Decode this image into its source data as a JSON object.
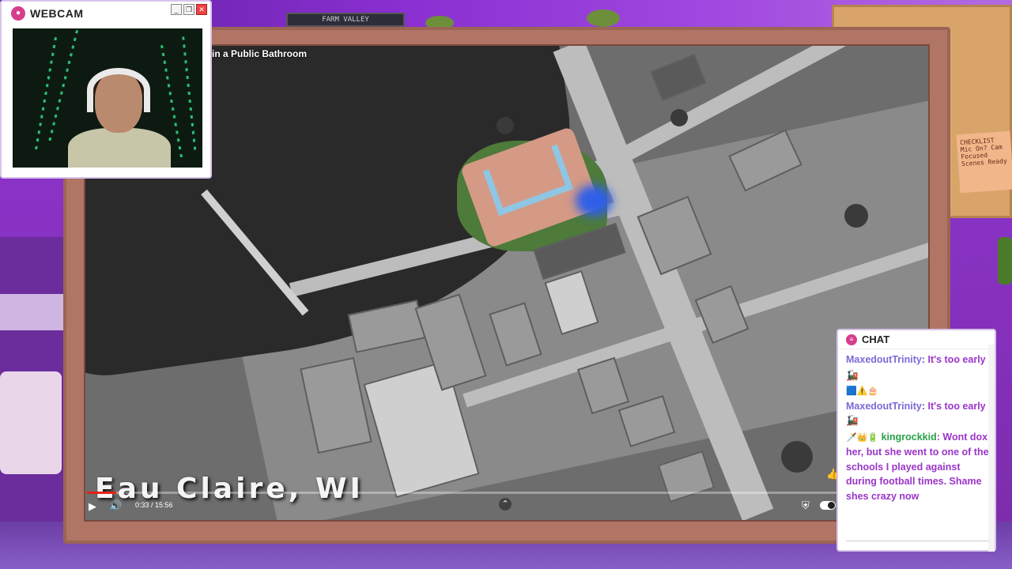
{
  "webcam": {
    "title": "WEBCAM",
    "controls": [
      "_",
      "❐",
      "✕"
    ]
  },
  "video": {
    "title": "in a Public Bathroom",
    "caption": "Eau Claire, WI",
    "time": "0:33 / 15:56",
    "progress": 0.035
  },
  "background": {
    "sign_text": "FARM VALLEY",
    "note_text": "CHECKLIST Mic On? Cam Focused Scenes Ready"
  },
  "chat": {
    "title": "CHAT",
    "messages": [
      {
        "badges": "",
        "user": "MaxedoutTrinity",
        "text": " It's too early 🚂"
      },
      {
        "badges": "🟦⚠️🎂",
        "user": "MaxedoutTrinity",
        "text": " It's too early 🚂"
      },
      {
        "badges": "🗡️👑🔋",
        "user": "kingrockkid",
        "text": " Wont dox her, but she went to one of the schools I played against during football times. Shame shes crazy now"
      }
    ]
  },
  "icons": {
    "play": "play-icon",
    "volume": "volume-icon",
    "camera": "camera-icon",
    "chat": "chat-icon"
  }
}
